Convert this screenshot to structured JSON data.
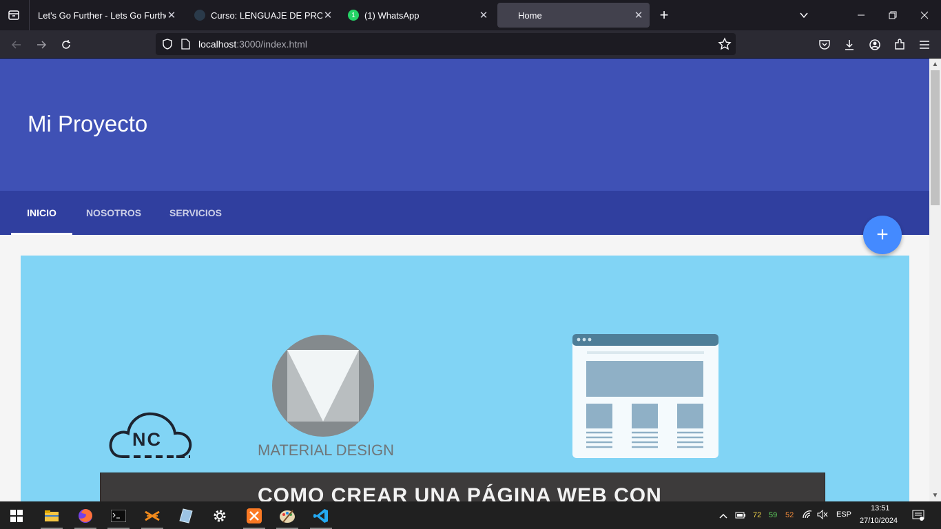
{
  "browser": {
    "tabs": [
      {
        "title": "Let's Go Further - Lets Go Further - A",
        "close": "✕"
      },
      {
        "title": "Curso: LENGUAJE DE PROGRAMACIÓN",
        "close": "✕"
      },
      {
        "title": "(1) WhatsApp",
        "badge": "1",
        "close": "✕"
      },
      {
        "title": "Home",
        "close": "✕"
      }
    ],
    "new_tab": "+",
    "url_host": "localhost",
    "url_rest": ":3000/index.html"
  },
  "page": {
    "brand": "Mi Proyecto",
    "nav_tabs": [
      "INICIO",
      "NOSOTROS",
      "SERVICIOS"
    ],
    "fab": "+",
    "banner": {
      "logo_text": "NC",
      "material_label": "MATERIAL DESIGN",
      "headline": "COMO CREAR UNA PÁGINA WEB CON"
    }
  },
  "taskbar": {
    "cpu_temps": [
      "72",
      "59",
      "52"
    ],
    "lang": "ESP",
    "time": "13:51",
    "date": "27/10/2024"
  },
  "colors": {
    "primary": "#3f51b5",
    "primary_dark": "#303f9f",
    "accent": "#448aff",
    "banner_bg": "#81d4f5"
  }
}
